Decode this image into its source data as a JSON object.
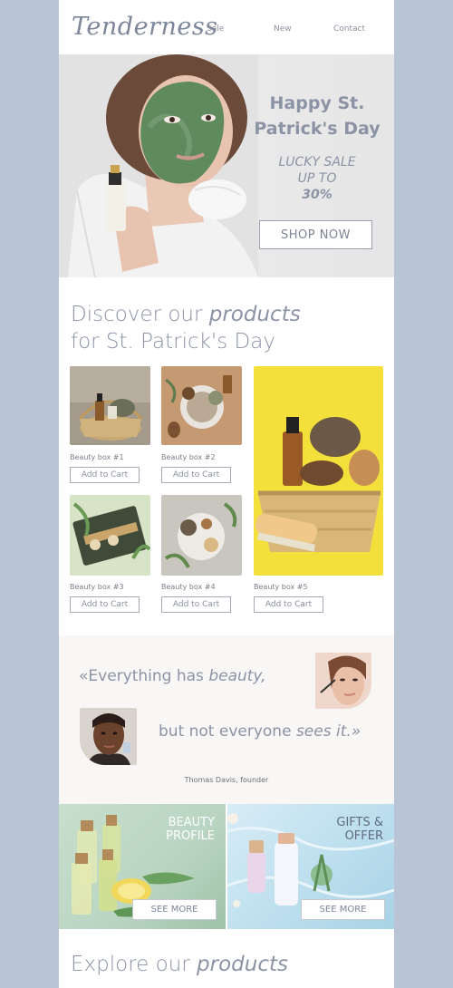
{
  "header": {
    "logo": "Tenderness",
    "nav": [
      "Sale",
      "New",
      "Contact"
    ]
  },
  "hero": {
    "title_line1": "Happy St.",
    "title_line2": "Patrick's Day",
    "sub_line1": "LUCKY SALE",
    "sub_line2": "UP TO",
    "sub_line3": "30%",
    "button": "SHOP NOW"
  },
  "discover": {
    "title_plain1": "Discover our",
    "title_italic": "products",
    "title_line2": "for St. Patrick's Day"
  },
  "products": [
    {
      "label": "Beauty box #1",
      "button": "Add to Cart"
    },
    {
      "label": "Beauty box #2",
      "button": "Add to Cart"
    },
    {
      "label": "Beauty box #3",
      "button": "Add to Cart"
    },
    {
      "label": "Beauty box #4",
      "button": "Add to Cart"
    },
    {
      "label": "Beauty box #5",
      "button": "Add to Cart"
    }
  ],
  "quote": {
    "line1_plain": "«Everything has",
    "line1_italic": "beauty,",
    "line2_plain": "but not everyone",
    "line2_italic": "sees it.»",
    "author": "Thomas Davis, founder"
  },
  "banners": [
    {
      "title_line1": "BEAUTY",
      "title_line2": "PROFILE",
      "button": "SEE MORE"
    },
    {
      "title_line1": "GIFTS &",
      "title_line2": "OFFER",
      "button": "SEE MORE"
    }
  ],
  "explore": {
    "title_plain": "Explore our",
    "title_italic": "products"
  },
  "colors": {
    "page_bg": "#b9c4d4",
    "accent_text": "#8b93a5",
    "quote_bg": "#f8f7f5"
  }
}
